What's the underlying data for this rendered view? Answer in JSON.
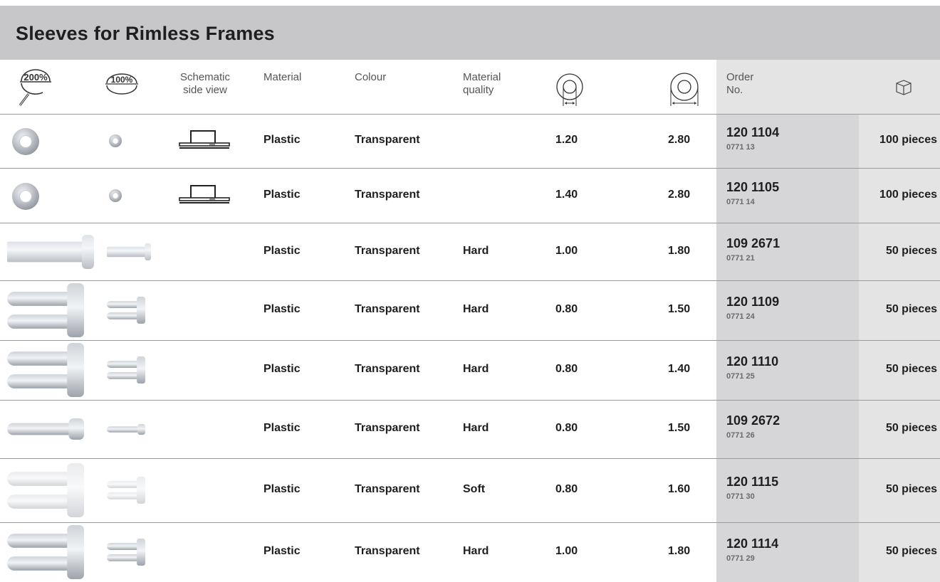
{
  "title": "Sleeves for Rimless Frames",
  "headers": {
    "zoom200": "200%",
    "zoom100": "100%",
    "schematic": [
      "Schematic",
      "side view"
    ],
    "material": "Material",
    "colour": "Colour",
    "quality": [
      "Material",
      "quality"
    ],
    "order": [
      "Order",
      "No."
    ],
    "inner_icon": "inner-diameter-icon",
    "outer_icon": "outer-diameter-icon",
    "package_icon": "package-box-icon"
  },
  "rows": [
    {
      "shape": "ring",
      "material": "Plastic",
      "colour": "Transparent",
      "quality": "",
      "inner": "1.20",
      "outer": "2.80",
      "order": "120 1104",
      "sub": "0771 13",
      "pieces": "100 pieces"
    },
    {
      "shape": "ring",
      "material": "Plastic",
      "colour": "Transparent",
      "quality": "",
      "inner": "1.40",
      "outer": "2.80",
      "order": "120 1105",
      "sub": "0771 14",
      "pieces": "100 pieces"
    },
    {
      "shape": "tube",
      "material": "Plastic",
      "colour": "Transparent",
      "quality": "Hard",
      "inner": "1.00",
      "outer": "1.80",
      "order": "109 2671",
      "sub": "0771 21",
      "pieces": "50 pieces"
    },
    {
      "shape": "double",
      "material": "Plastic",
      "colour": "Transparent",
      "quality": "Hard",
      "inner": "0.80",
      "outer": "1.50",
      "order": "120 1109",
      "sub": "0771 24",
      "pieces": "50 pieces"
    },
    {
      "shape": "double",
      "material": "Plastic",
      "colour": "Transparent",
      "quality": "Hard",
      "inner": "0.80",
      "outer": "1.40",
      "order": "120 1110",
      "sub": "0771 25",
      "pieces": "50 pieces"
    },
    {
      "shape": "single",
      "material": "Plastic",
      "colour": "Transparent",
      "quality": "Hard",
      "inner": "0.80",
      "outer": "1.50",
      "order": "109 2672",
      "sub": "0771 26",
      "pieces": "50 pieces"
    },
    {
      "shape": "soft",
      "material": "Plastic",
      "colour": "Transparent",
      "quality": "Soft",
      "inner": "0.80",
      "outer": "1.60",
      "order": "120 1115",
      "sub": "0771 30",
      "pieces": "50 pieces"
    },
    {
      "shape": "double",
      "material": "Plastic",
      "colour": "Transparent",
      "quality": "Hard",
      "inner": "1.00",
      "outer": "1.80",
      "order": "120 1114",
      "sub": "0771 29",
      "pieces": "50 pieces"
    }
  ]
}
